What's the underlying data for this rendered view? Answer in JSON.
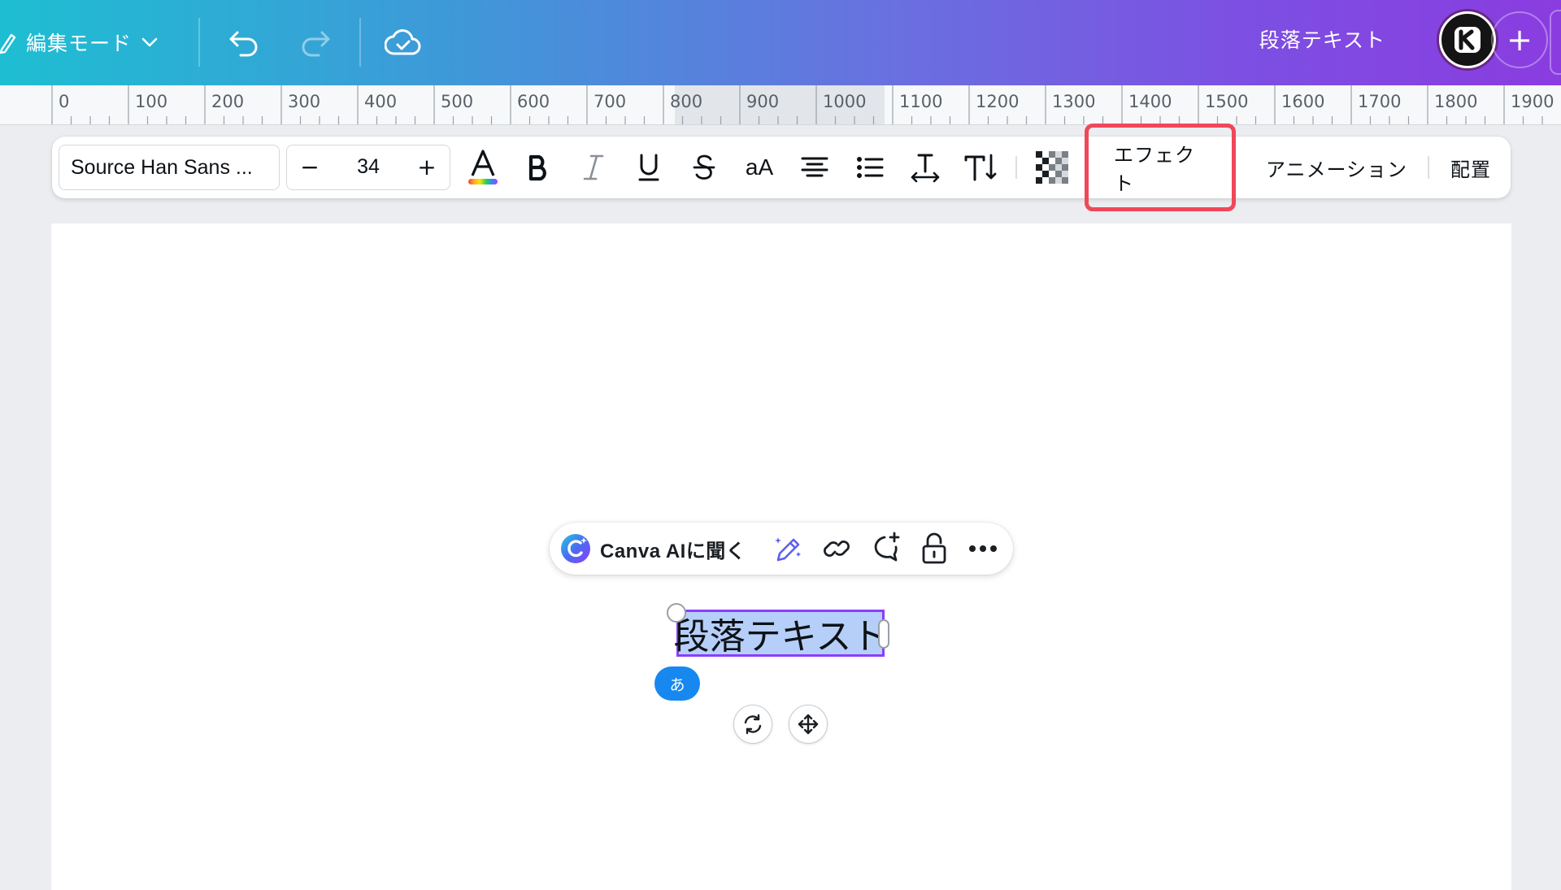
{
  "topbar": {
    "edit_mode_label": "編集モード",
    "doc_title": "段落テキスト",
    "plus_label": "+"
  },
  "ruler": {
    "labels": [
      "0",
      "100",
      "200",
      "300",
      "400",
      "500",
      "600",
      "700",
      "800",
      "900",
      "1000",
      "1100",
      "1200",
      "1300",
      "1400",
      "1500",
      "1600",
      "1700",
      "1800",
      "1900"
    ]
  },
  "format_toolbar": {
    "font_family": "Source Han Sans ...",
    "font_size": "34",
    "size_minus": "−",
    "size_plus": "+",
    "case_label": "aA",
    "effects_label": "エフェクト",
    "animation_label": "アニメーション",
    "position_label": "配置"
  },
  "context_bar": {
    "ask_ai_label": "Canva AIに聞く"
  },
  "canvas": {
    "selected_text": "段落テキスト",
    "ime_badge": "あ"
  },
  "colors": {
    "accent_purple": "#8b3dff",
    "highlight_red": "#f0475a",
    "selection_fill": "#b6cff9",
    "ime_blue": "#1688f0"
  }
}
